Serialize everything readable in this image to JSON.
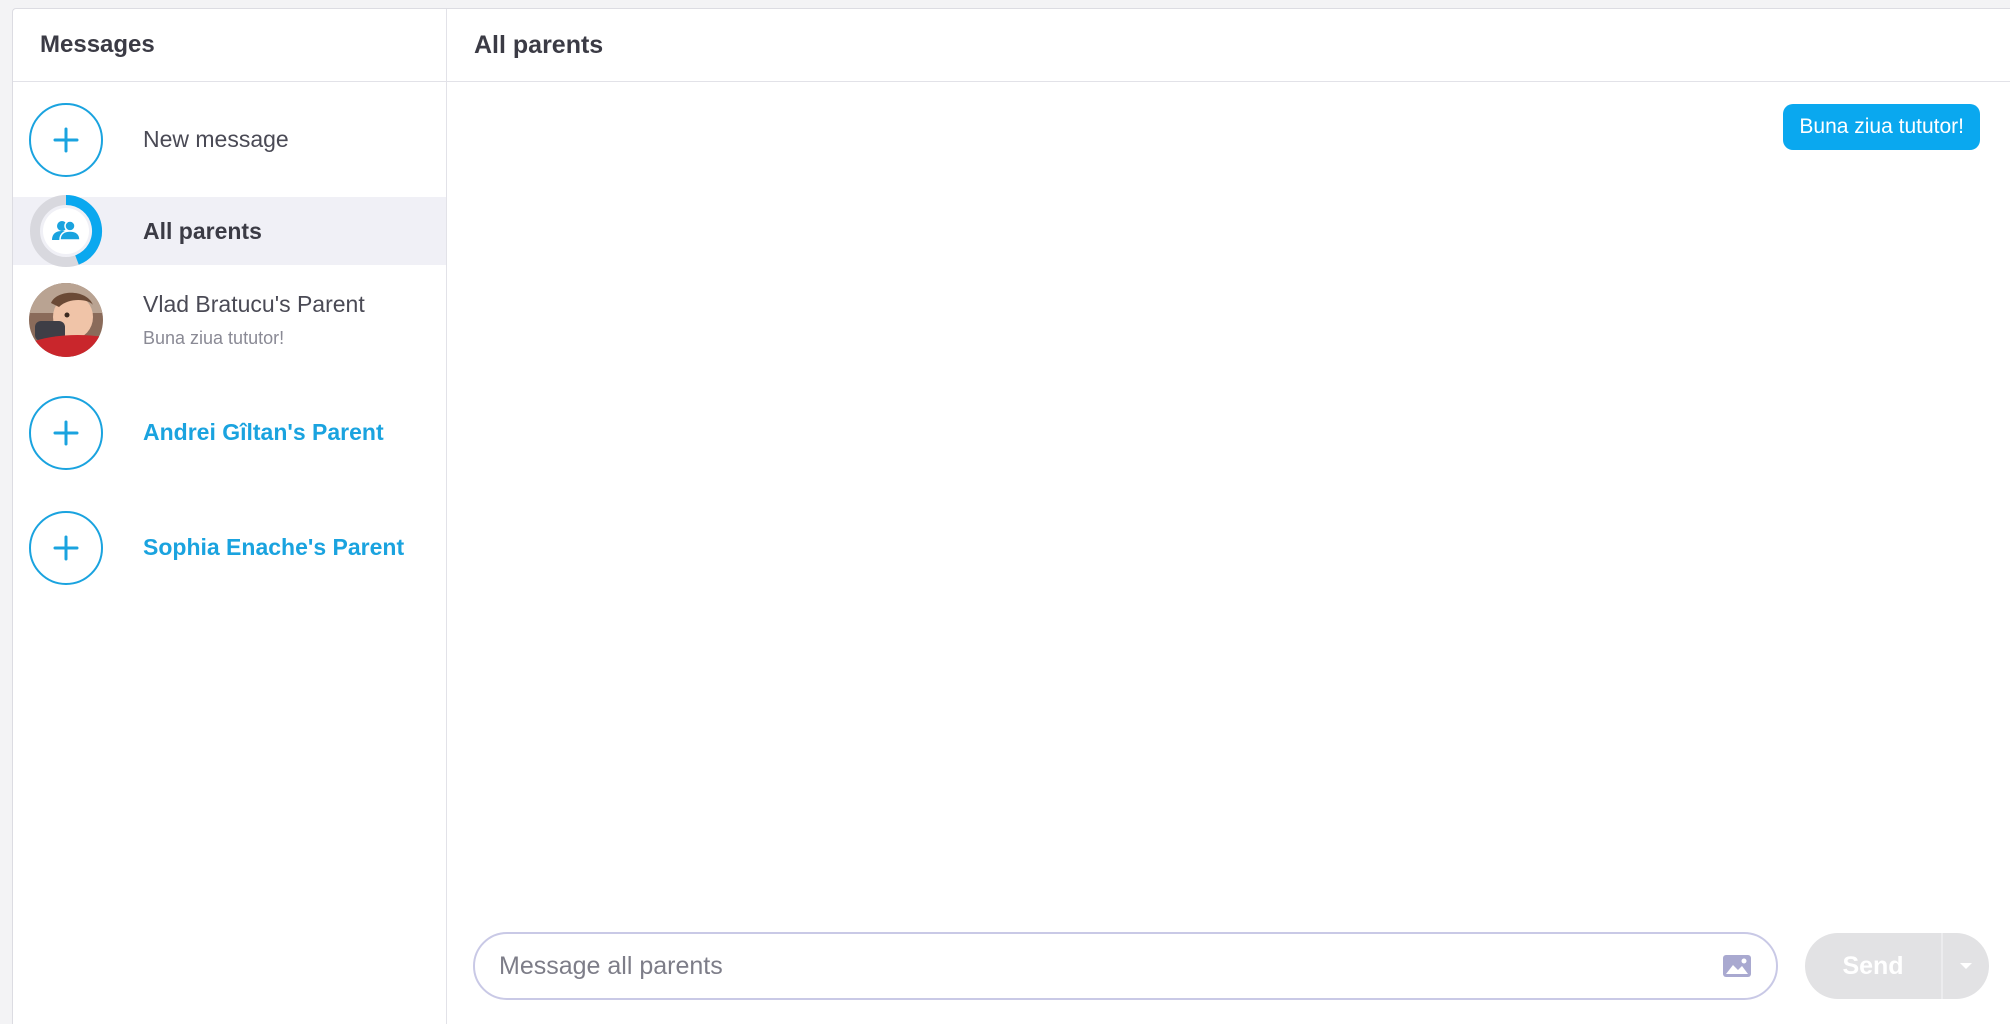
{
  "sidebar": {
    "title": "Messages",
    "new_message": {
      "label": "New message",
      "icon": "plus-icon"
    },
    "conversations": [
      {
        "name": "All parents",
        "icon": "parents-group-icon",
        "selected": true
      },
      {
        "name": "Vlad Bratucu's Parent",
        "preview": "Buna ziua tututor!"
      }
    ],
    "pending_parents": [
      {
        "name": "Andrei Gîltan's Parent",
        "icon": "plus-icon"
      },
      {
        "name": "Sophia Enache's Parent",
        "icon": "plus-icon"
      }
    ]
  },
  "main": {
    "title": "All parents",
    "messages": [
      {
        "text": "Buna ziua tututor!"
      }
    ],
    "composer": {
      "placeholder": "Message all parents",
      "value": "",
      "image_icon": "image-icon",
      "send_label": "Send",
      "options_icon": "caret-down-icon"
    }
  },
  "colors": {
    "accent": "#1aa3df",
    "bubble": "#0aa8ef",
    "selected_row": "#f0f0f6",
    "send_disabled": "#e2e2e4"
  }
}
